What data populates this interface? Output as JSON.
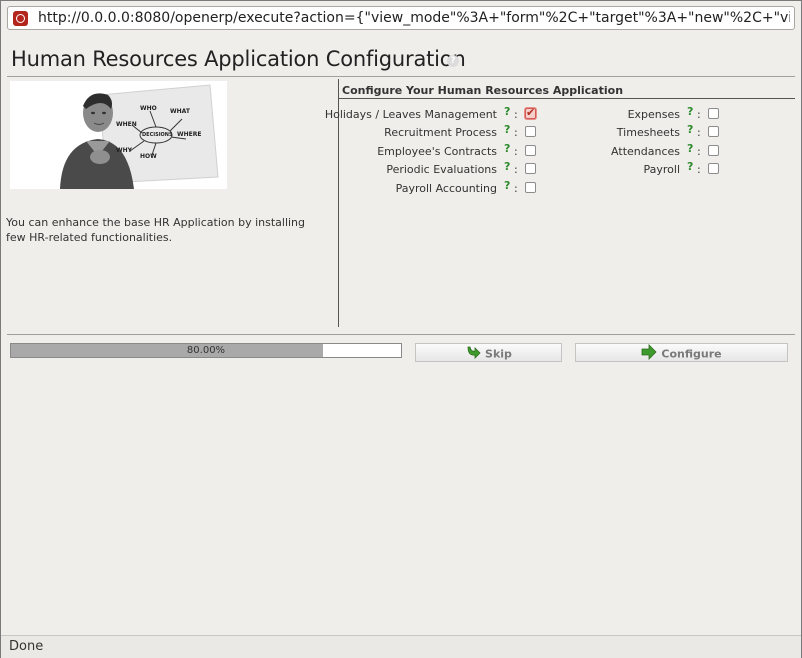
{
  "browser": {
    "url": "http://0.0.0.0:8080/openerp/execute?action={\"view_mode\"%3A+\"form\"%2C+\"target\"%3A+\"new\"%2C+\"view_ty",
    "status": "Done"
  },
  "page": {
    "title": "Human Resources Application Configuration",
    "help_glyph": "?",
    "description": "You can enhance the base HR Application by installing few HR-related functionalities."
  },
  "illustration": {
    "words": [
      "WHO",
      "WHAT",
      "WHERE",
      "WHEN",
      "WHY",
      "HOW",
      "DECISIONS"
    ]
  },
  "section": {
    "title": "Configure Your Human Resources Application"
  },
  "options": {
    "left": [
      {
        "label": "Holidays / Leaves Management",
        "checked": true
      },
      {
        "label": "Recruitment Process",
        "checked": false
      },
      {
        "label": "Employee's Contracts",
        "checked": false
      },
      {
        "label": "Periodic Evaluations",
        "checked": false
      },
      {
        "label": "Payroll Accounting",
        "checked": false
      }
    ],
    "right": [
      {
        "label": "Expenses",
        "checked": false
      },
      {
        "label": "Timesheets",
        "checked": false
      },
      {
        "label": "Attendances",
        "checked": false
      },
      {
        "label": "Payroll",
        "checked": false
      }
    ],
    "help_mark": "?",
    "separator": ":"
  },
  "progress": {
    "value": 0.8,
    "label": "80.00%"
  },
  "buttons": {
    "skip": "Skip",
    "configure": "Configure"
  },
  "colors": {
    "accent_green": "#2d8b2d",
    "checked_red": "#b0301f"
  }
}
